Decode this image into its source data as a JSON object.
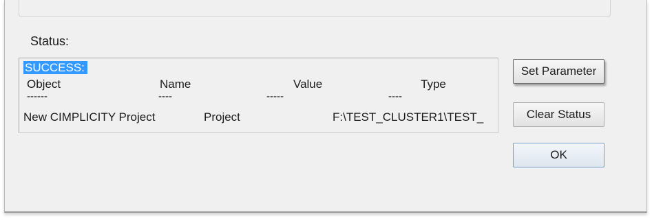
{
  "status": {
    "label": "Status:",
    "lines": {
      "result": "SUCCESS:",
      "header": {
        "object": "Object",
        "name": "Name",
        "value": "Value",
        "type": "Type"
      },
      "separator": {
        "object": "------",
        "name": "----",
        "value": "-----",
        "type": "----"
      },
      "row": {
        "object": "New CIMPLICITY Project",
        "name": "Project",
        "value": "F:\\TEST_CLUSTER1\\TEST_"
      }
    }
  },
  "buttons": {
    "set_parameter": "Set Parameter",
    "clear_status": "Clear Status",
    "ok": "OK"
  },
  "colors": {
    "selection": "#3399ff",
    "dialog_background": "#f0f0f0"
  }
}
